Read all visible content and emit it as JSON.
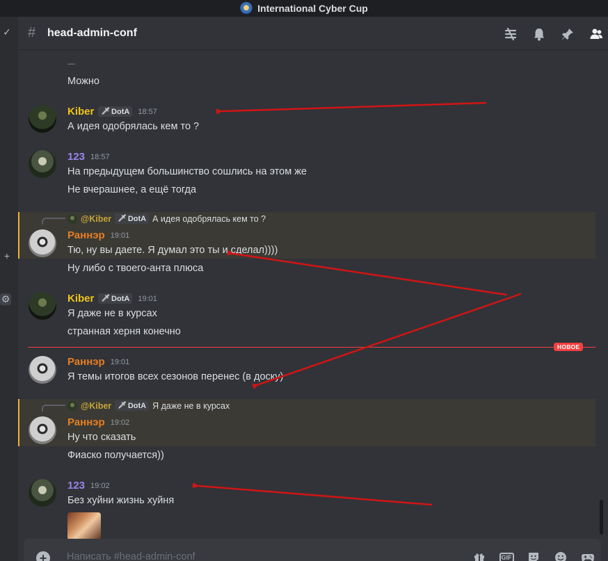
{
  "app": {
    "server_name": "International Cyber Cup"
  },
  "channel": {
    "name": "head-admin-conf",
    "hash": "#"
  },
  "composer": {
    "placeholder": "Написать #head-admin-conf",
    "gif_label": "GIF"
  },
  "new_divider": {
    "label": "НОВОЕ"
  },
  "role_tag": "DotA",
  "messages": [
    {
      "kind": "continuation",
      "lines": [
        "Можно"
      ]
    },
    {
      "kind": "message",
      "author": "Kiber",
      "author_color": "#f0c419",
      "tag": "DotA",
      "time": "18:57",
      "lines": [
        "А идея одобрялась кем то ?"
      ]
    },
    {
      "kind": "message",
      "author": "123",
      "author_color": "#9b84ee",
      "time": "18:57",
      "lines": [
        "На предыдущем большинство сошлись на этом же",
        "Не вчерашнее, а ещё тогда"
      ]
    },
    {
      "kind": "reply",
      "reply_to": {
        "mention": "@Kiber",
        "tag": "DotA",
        "text": "А идея одобрялась кем то ?"
      },
      "author": "Раннэр",
      "author_color": "#e67e22",
      "time": "19:01",
      "lines": [
        "Тю, ну вы даете. Я думал это ты и сделал))))",
        "Ну либо с твоего-анта плюса"
      ]
    },
    {
      "kind": "message",
      "author": "Kiber",
      "author_color": "#f0c419",
      "tag": "DotA",
      "time": "19:01",
      "lines": [
        "Я даже не в курсах",
        "странная херня конечно"
      ]
    },
    {
      "kind": "message",
      "author": "Раннэр",
      "author_color": "#e67e22",
      "time": "19:01",
      "lines": [
        "Я темы итогов всех сезонов перенес (в доску)"
      ]
    },
    {
      "kind": "reply",
      "reply_to": {
        "mention": "@Kiber",
        "tag": "DotA",
        "text": "Я даже не в курсах"
      },
      "author": "Раннэр",
      "author_color": "#e67e22",
      "time": "19:02",
      "lines": [
        "Ну что сказать",
        "Фиаско получается))"
      ]
    },
    {
      "kind": "message",
      "author": "123",
      "author_color": "#9b84ee",
      "time": "19:02",
      "lines": [
        "Без хуйни жизнь хуйня"
      ],
      "has_gif": true
    }
  ],
  "colors": {
    "annotation_arrow": "#d21414",
    "new_red": "#f23f42",
    "highlight_border": "#f0b232"
  }
}
